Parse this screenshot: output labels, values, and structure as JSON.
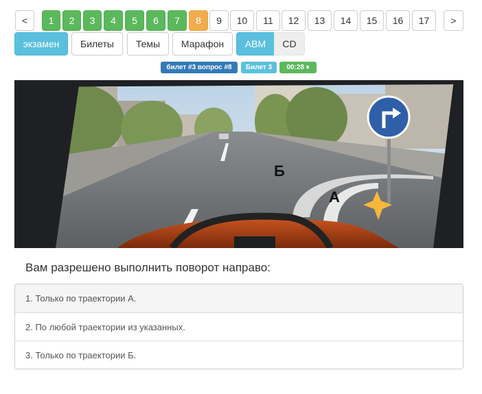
{
  "pagination": {
    "prev": "<",
    "next": ">",
    "pages": [
      {
        "label": "1",
        "state": "answered"
      },
      {
        "label": "2",
        "state": "answered"
      },
      {
        "label": "3",
        "state": "answered"
      },
      {
        "label": "4",
        "state": "answered"
      },
      {
        "label": "5",
        "state": "answered"
      },
      {
        "label": "6",
        "state": "answered"
      },
      {
        "label": "7",
        "state": "answered"
      },
      {
        "label": "8",
        "state": "current"
      },
      {
        "label": "9",
        "state": "default"
      },
      {
        "label": "10",
        "state": "default"
      },
      {
        "label": "11",
        "state": "default"
      },
      {
        "label": "12",
        "state": "default"
      },
      {
        "label": "13",
        "state": "default"
      },
      {
        "label": "14",
        "state": "default"
      },
      {
        "label": "15",
        "state": "default"
      },
      {
        "label": "16",
        "state": "default"
      },
      {
        "label": "17",
        "state": "default"
      }
    ]
  },
  "modes": {
    "exam": "экзамен",
    "tickets": "Билеты",
    "topics": "Темы",
    "marathon": "Марафон",
    "cat_abm": "ABM",
    "cat_cd": "CD"
  },
  "badges": {
    "ticket_question": "билет #3 вопрос #8",
    "ticket": "Билет 3",
    "timer": "00:28 ⏸"
  },
  "scene": {
    "label_b": "Б",
    "label_a": "А"
  },
  "question": "Вам разрешено выполнить поворот направо:",
  "answers": [
    "1. Только по траектории А.",
    "2. По любой траектории из указанных.",
    "3. Только по траектории Б."
  ],
  "colors": {
    "answered": "#5cb85c",
    "current": "#f0ad4e",
    "info": "#5bc0de",
    "primary": "#337ab7"
  }
}
